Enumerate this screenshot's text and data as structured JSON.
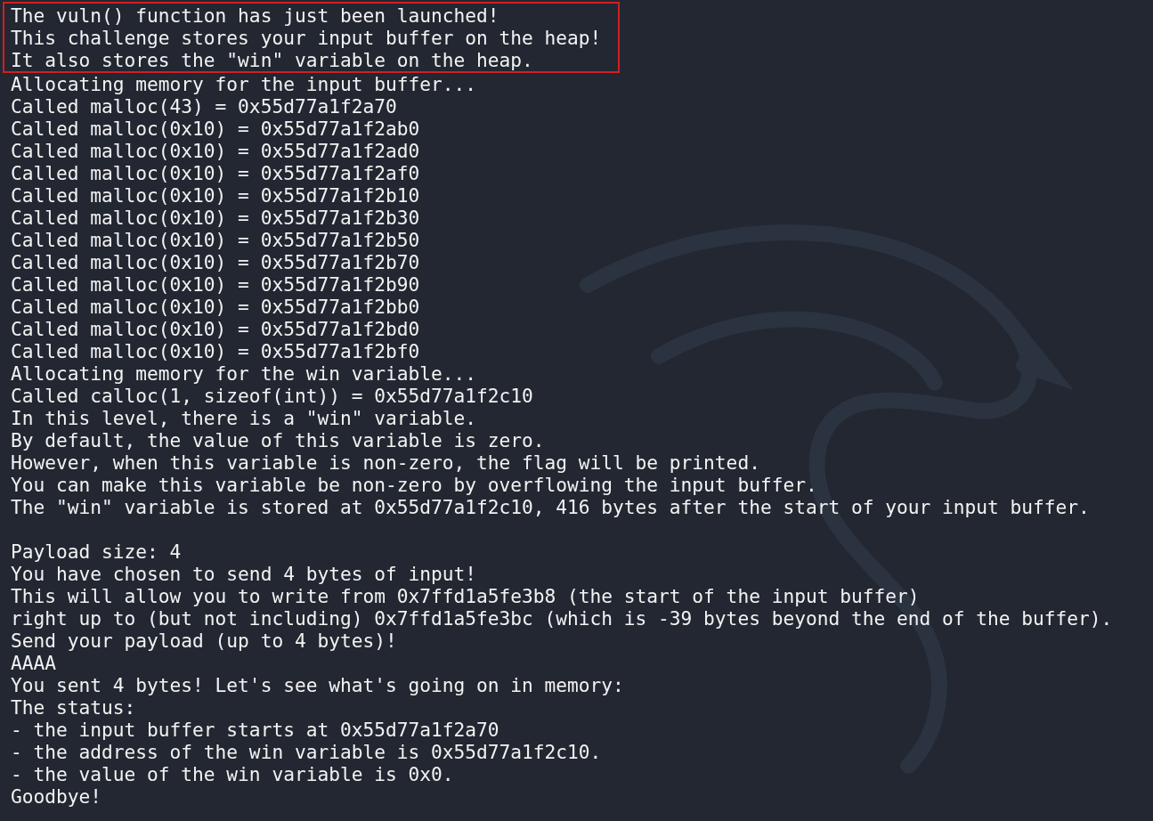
{
  "terminal": {
    "sections": [
      {
        "highlighted": true,
        "blank_before": false,
        "lines": [
          "The vuln() function has just been launched!",
          "This challenge stores your input buffer on the heap!",
          "It also stores the \"win\" variable on the heap."
        ]
      },
      {
        "highlighted": false,
        "blank_before": false,
        "lines": [
          "Allocating memory for the input buffer...",
          "Called malloc(43) = 0x55d77a1f2a70",
          "Called malloc(0x10) = 0x55d77a1f2ab0",
          "Called malloc(0x10) = 0x55d77a1f2ad0",
          "Called malloc(0x10) = 0x55d77a1f2af0",
          "Called malloc(0x10) = 0x55d77a1f2b10",
          "Called malloc(0x10) = 0x55d77a1f2b30",
          "Called malloc(0x10) = 0x55d77a1f2b50",
          "Called malloc(0x10) = 0x55d77a1f2b70",
          "Called malloc(0x10) = 0x55d77a1f2b90",
          "Called malloc(0x10) = 0x55d77a1f2bb0",
          "Called malloc(0x10) = 0x55d77a1f2bd0",
          "Called malloc(0x10) = 0x55d77a1f2bf0",
          "Allocating memory for the win variable...",
          "Called calloc(1, sizeof(int)) = 0x55d77a1f2c10",
          "In this level, there is a \"win\" variable.",
          "By default, the value of this variable is zero.",
          "However, when this variable is non-zero, the flag will be printed.",
          "You can make this variable be non-zero by overflowing the input buffer.",
          "The \"win\" variable is stored at 0x55d77a1f2c10, 416 bytes after the start of your input buffer."
        ]
      },
      {
        "highlighted": false,
        "blank_before": true,
        "lines": [
          "Payload size: 4",
          "You have chosen to send 4 bytes of input!",
          "This will allow you to write from 0x7ffd1a5fe3b8 (the start of the input buffer)",
          "right up to (but not including) 0x7ffd1a5fe3bc (which is -39 bytes beyond the end of the buffer).",
          "Send your payload (up to 4 bytes)!",
          "AAAA",
          "You sent 4 bytes! Let's see what's going on in memory:",
          "The status:",
          "- the input buffer starts at 0x55d77a1f2a70",
          "- the address of the win variable is 0x55d77a1f2c10.",
          "- the value of the win variable is 0x0.",
          "Goodbye!"
        ]
      }
    ]
  }
}
